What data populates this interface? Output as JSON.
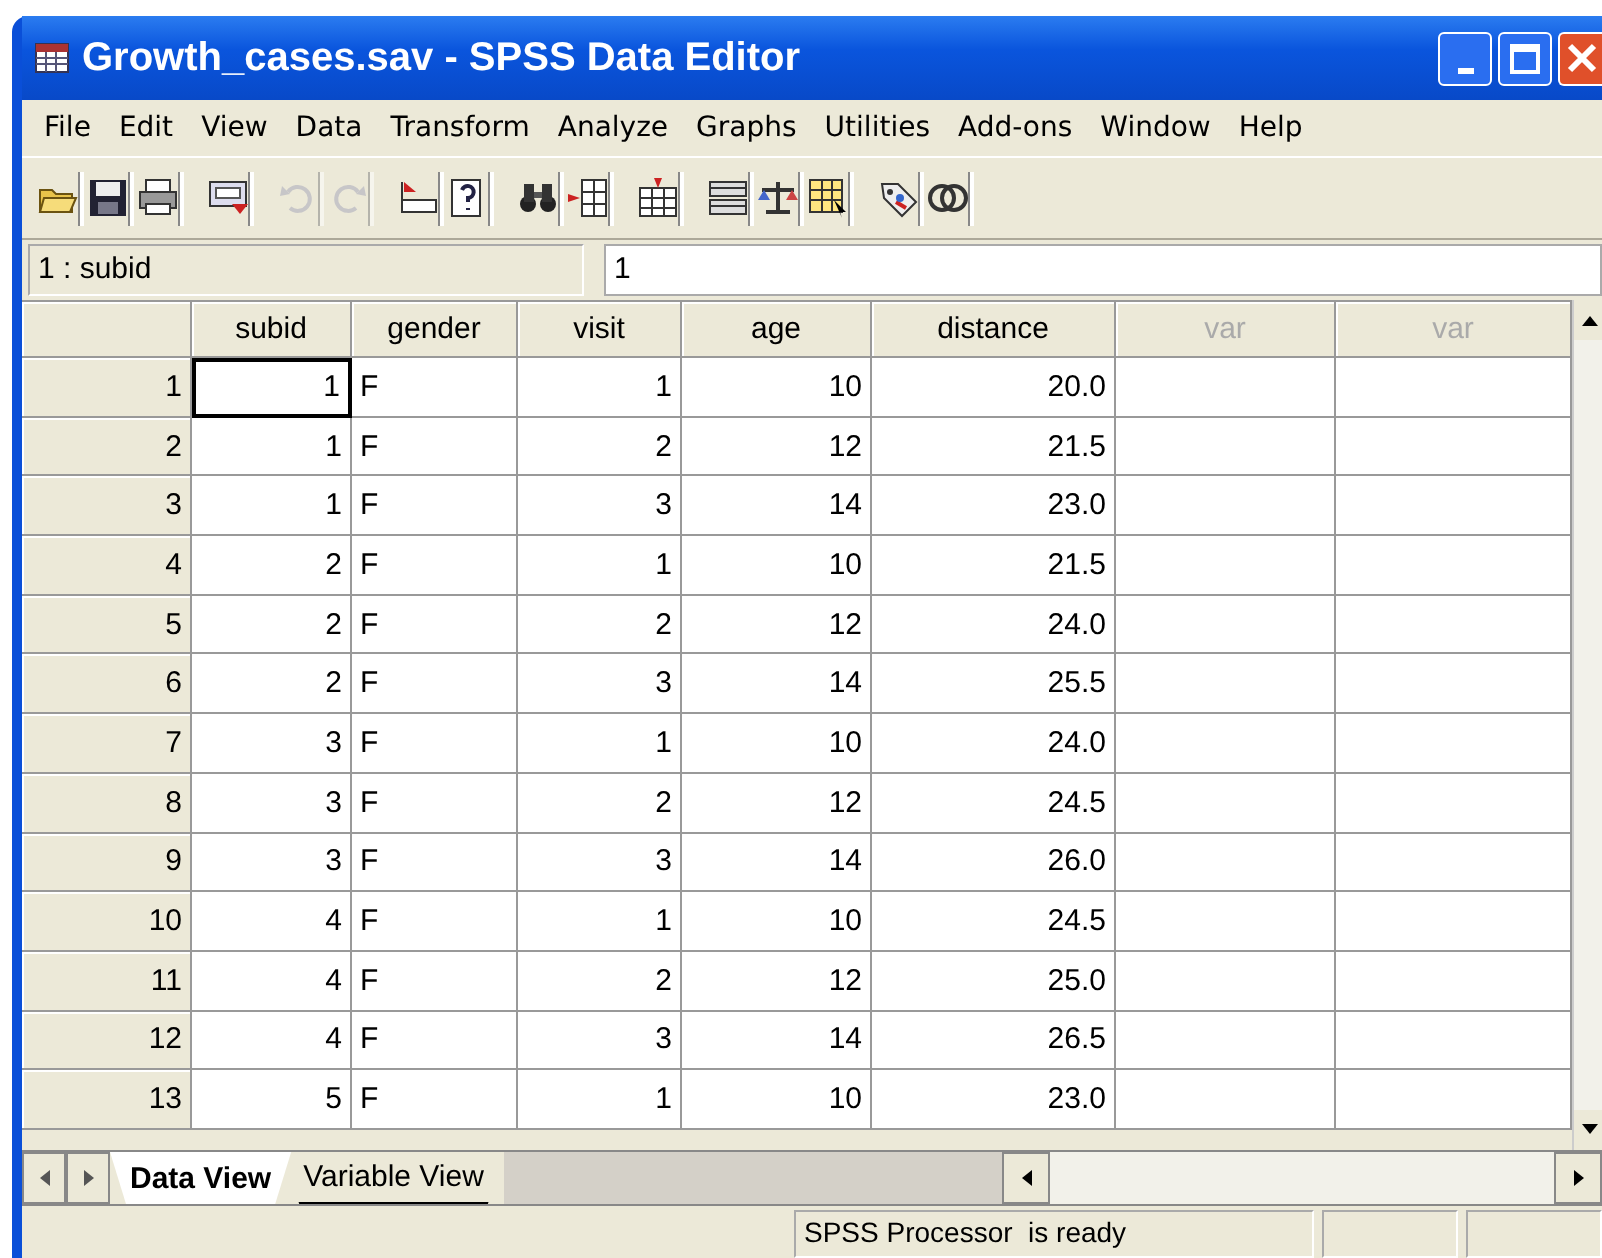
{
  "window": {
    "title": "Growth_cases.sav - SPSS Data Editor"
  },
  "menu": [
    {
      "label": "File"
    },
    {
      "label": "Edit"
    },
    {
      "label": "View"
    },
    {
      "label": "Data"
    },
    {
      "label": "Transform"
    },
    {
      "label": "Analyze"
    },
    {
      "label": "Graphs"
    },
    {
      "label": "Utilities"
    },
    {
      "label": "Add-ons"
    },
    {
      "label": "Window"
    },
    {
      "label": "Help"
    }
  ],
  "toolbar": [
    {
      "kind": "open",
      "disabled": false
    },
    {
      "kind": "save",
      "disabled": false
    },
    {
      "kind": "print",
      "disabled": false
    },
    {
      "kind": "dialog",
      "disabled": false
    },
    {
      "kind": "undo",
      "disabled": true
    },
    {
      "kind": "redo",
      "disabled": true
    },
    {
      "kind": "goto",
      "disabled": false
    },
    {
      "kind": "variables",
      "disabled": false
    },
    {
      "kind": "find",
      "disabled": false
    },
    {
      "kind": "insertcase",
      "disabled": false
    },
    {
      "kind": "insertvar",
      "disabled": false
    },
    {
      "kind": "split",
      "disabled": false
    },
    {
      "kind": "weight",
      "disabled": false
    },
    {
      "kind": "select",
      "disabled": false
    },
    {
      "kind": "labels",
      "disabled": false
    },
    {
      "kind": "sets",
      "disabled": false
    }
  ],
  "cell_editor": {
    "reference": "1 : subid",
    "value": "1"
  },
  "grid": {
    "columns": [
      {
        "label": "subid",
        "kind": "numeric"
      },
      {
        "label": "gender",
        "kind": "string"
      },
      {
        "label": "visit",
        "kind": "numeric"
      },
      {
        "label": "age",
        "kind": "numeric"
      },
      {
        "label": "distance",
        "kind": "numeric"
      },
      {
        "label": "var",
        "kind": "empty"
      },
      {
        "label": "var",
        "kind": "empty"
      }
    ],
    "rows": [
      {
        "label": "1",
        "cells": [
          {
            "text": "1",
            "selected": true
          },
          {
            "text": "F",
            "selected": false
          },
          {
            "text": "1",
            "selected": false
          },
          {
            "text": "10",
            "selected": false
          },
          {
            "text": "20.0",
            "selected": false
          }
        ]
      },
      {
        "label": "2",
        "cells": [
          {
            "text": "1",
            "selected": false
          },
          {
            "text": "F",
            "selected": false
          },
          {
            "text": "2",
            "selected": false
          },
          {
            "text": "12",
            "selected": false
          },
          {
            "text": "21.5",
            "selected": false
          }
        ]
      },
      {
        "label": "3",
        "cells": [
          {
            "text": "1",
            "selected": false
          },
          {
            "text": "F",
            "selected": false
          },
          {
            "text": "3",
            "selected": false
          },
          {
            "text": "14",
            "selected": false
          },
          {
            "text": "23.0",
            "selected": false
          }
        ]
      },
      {
        "label": "4",
        "cells": [
          {
            "text": "2",
            "selected": false
          },
          {
            "text": "F",
            "selected": false
          },
          {
            "text": "1",
            "selected": false
          },
          {
            "text": "10",
            "selected": false
          },
          {
            "text": "21.5",
            "selected": false
          }
        ]
      },
      {
        "label": "5",
        "cells": [
          {
            "text": "2",
            "selected": false
          },
          {
            "text": "F",
            "selected": false
          },
          {
            "text": "2",
            "selected": false
          },
          {
            "text": "12",
            "selected": false
          },
          {
            "text": "24.0",
            "selected": false
          }
        ]
      },
      {
        "label": "6",
        "cells": [
          {
            "text": "2",
            "selected": false
          },
          {
            "text": "F",
            "selected": false
          },
          {
            "text": "3",
            "selected": false
          },
          {
            "text": "14",
            "selected": false
          },
          {
            "text": "25.5",
            "selected": false
          }
        ]
      },
      {
        "label": "7",
        "cells": [
          {
            "text": "3",
            "selected": false
          },
          {
            "text": "F",
            "selected": false
          },
          {
            "text": "1",
            "selected": false
          },
          {
            "text": "10",
            "selected": false
          },
          {
            "text": "24.0",
            "selected": false
          }
        ]
      },
      {
        "label": "8",
        "cells": [
          {
            "text": "3",
            "selected": false
          },
          {
            "text": "F",
            "selected": false
          },
          {
            "text": "2",
            "selected": false
          },
          {
            "text": "12",
            "selected": false
          },
          {
            "text": "24.5",
            "selected": false
          }
        ]
      },
      {
        "label": "9",
        "cells": [
          {
            "text": "3",
            "selected": false
          },
          {
            "text": "F",
            "selected": false
          },
          {
            "text": "3",
            "selected": false
          },
          {
            "text": "14",
            "selected": false
          },
          {
            "text": "26.0",
            "selected": false
          }
        ]
      },
      {
        "label": "10",
        "cells": [
          {
            "text": "4",
            "selected": false
          },
          {
            "text": "F",
            "selected": false
          },
          {
            "text": "1",
            "selected": false
          },
          {
            "text": "10",
            "selected": false
          },
          {
            "text": "24.5",
            "selected": false
          }
        ]
      },
      {
        "label": "11",
        "cells": [
          {
            "text": "4",
            "selected": false
          },
          {
            "text": "F",
            "selected": false
          },
          {
            "text": "2",
            "selected": false
          },
          {
            "text": "12",
            "selected": false
          },
          {
            "text": "25.0",
            "selected": false
          }
        ]
      },
      {
        "label": "12",
        "cells": [
          {
            "text": "4",
            "selected": false
          },
          {
            "text": "F",
            "selected": false
          },
          {
            "text": "3",
            "selected": false
          },
          {
            "text": "14",
            "selected": false
          },
          {
            "text": "26.5",
            "selected": false
          }
        ]
      },
      {
        "label": "13",
        "cells": [
          {
            "text": "5",
            "selected": false
          },
          {
            "text": "F",
            "selected": false
          },
          {
            "text": "1",
            "selected": false
          },
          {
            "text": "10",
            "selected": false
          },
          {
            "text": "23.0",
            "selected": false
          }
        ]
      }
    ]
  },
  "tabs": [
    {
      "label": "Data View",
      "selected": true
    },
    {
      "label": "Variable View",
      "selected": false
    }
  ],
  "status_bar": {
    "message": "SPSS Processor  is ready"
  }
}
